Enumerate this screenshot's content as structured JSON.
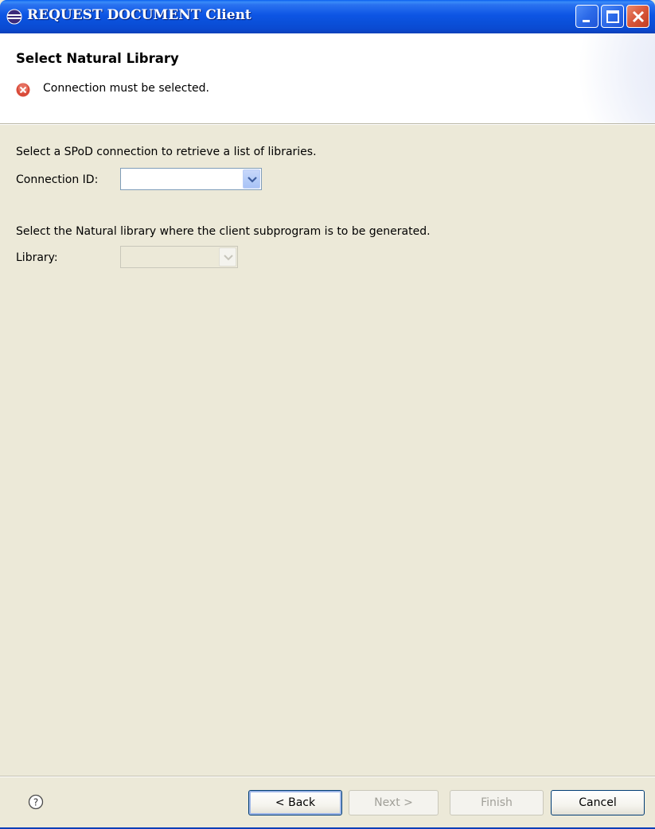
{
  "window": {
    "title": "REQUEST DOCUMENT Client",
    "title_icon": "eclipse-icon",
    "controls": [
      "minimize-icon",
      "maximize-icon",
      "close-icon"
    ]
  },
  "header": {
    "title": "Select Natural Library",
    "message": "Connection must be selected.",
    "message_icon": "error-icon"
  },
  "connection": {
    "instruction": "Select a SPoD connection to retrieve a list of libraries.",
    "label": "Connection ID:",
    "value": ""
  },
  "library": {
    "instruction": "Select the Natural library where the client subprogram is to be generated.",
    "label": "Library:",
    "value": "",
    "enabled": false
  },
  "footer": {
    "help_icon": "help-icon",
    "back_label": "< Back",
    "next_label": "Next >",
    "finish_label": "Finish",
    "cancel_label": "Cancel"
  },
  "colors": {
    "title_bar": "#0a4fd8",
    "dialog_bg": "#ece9d8",
    "error_red": "#d94b3a"
  }
}
